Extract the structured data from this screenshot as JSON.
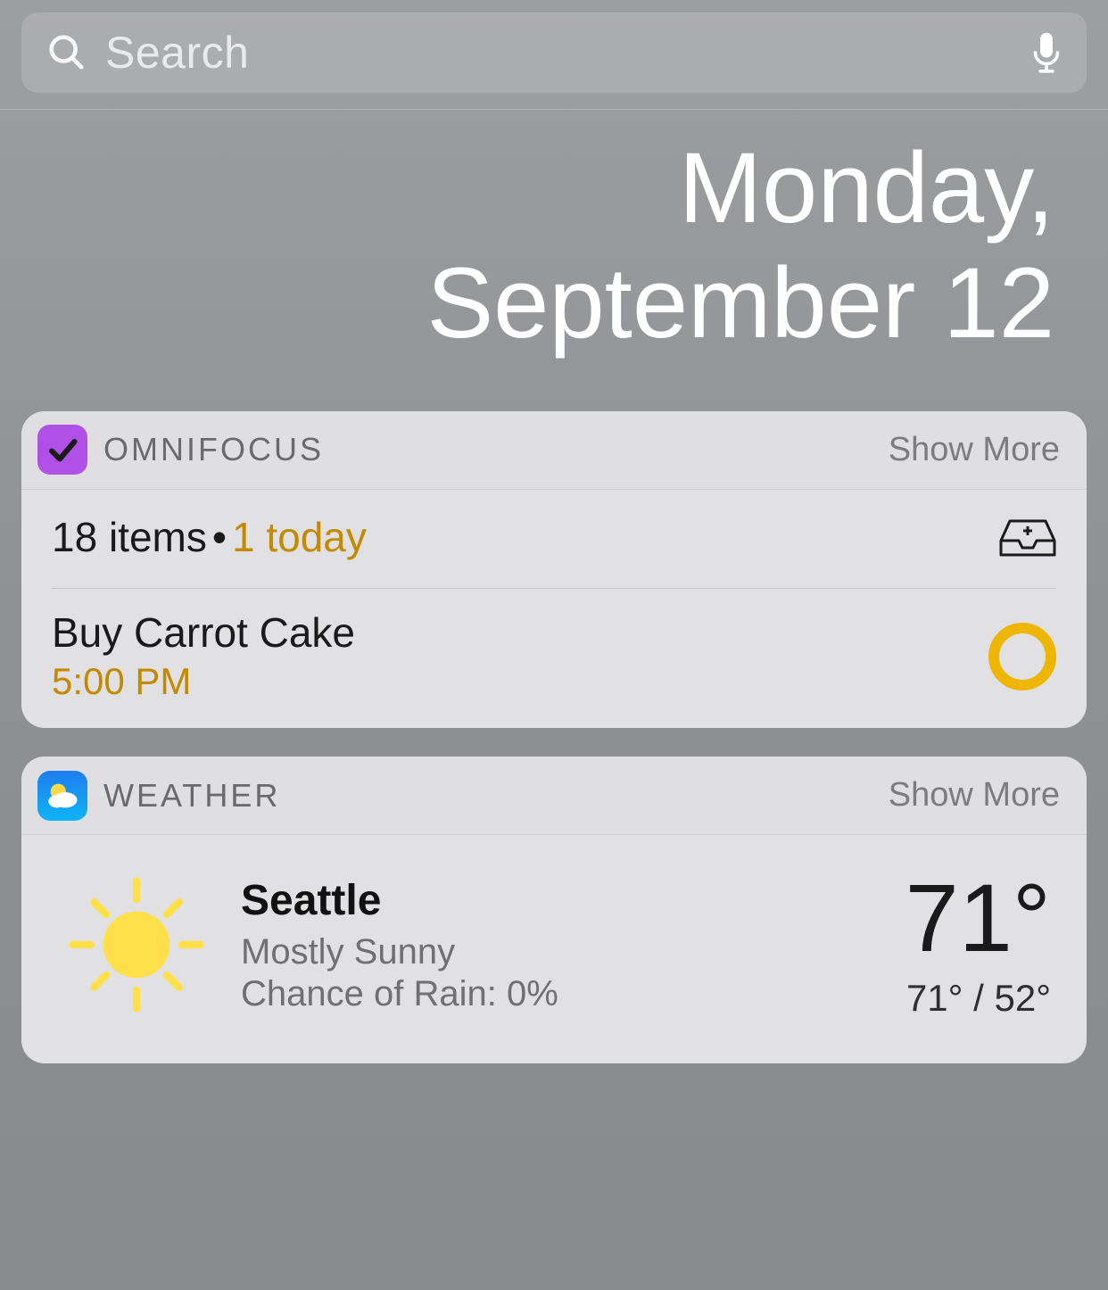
{
  "search": {
    "placeholder": "Search"
  },
  "date": {
    "line1": "Monday,",
    "line2": "September 12"
  },
  "omnifocus": {
    "title": "OMNIFOCUS",
    "show_more": "Show More",
    "summary_items": "18 items",
    "summary_separator": "•",
    "summary_today": "1 today",
    "task": {
      "title": "Buy Carrot Cake",
      "time": "5:00 PM"
    }
  },
  "weather": {
    "title": "WEATHER",
    "show_more": "Show More",
    "city": "Seattle",
    "condition": "Mostly Sunny",
    "rain_label": "Chance of Rain: 0%",
    "temp_now": "71°",
    "temp_hilo": "71° / 52°"
  }
}
